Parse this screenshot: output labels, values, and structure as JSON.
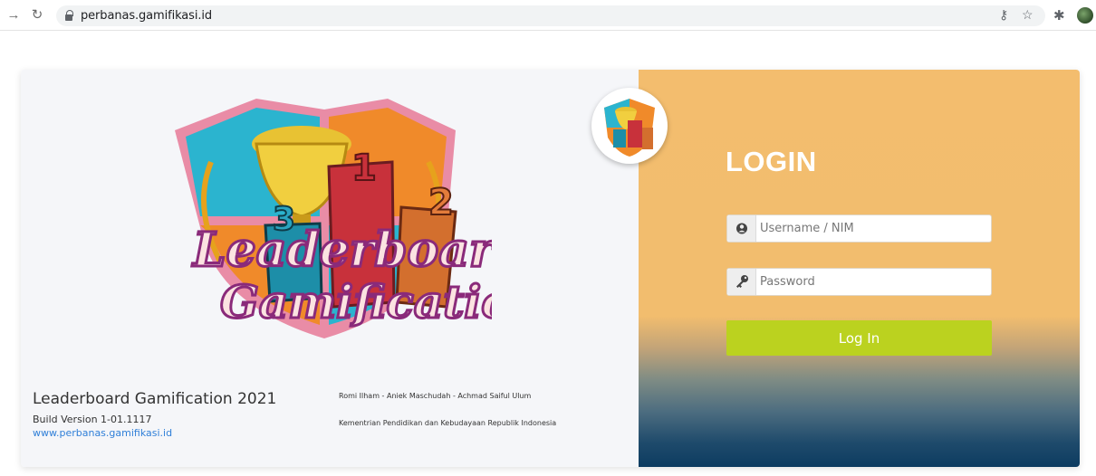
{
  "browser": {
    "url": "perbanas.gamifikasi.id",
    "back_icon": "back-arrow-icon",
    "reload_icon": "reload-icon",
    "key_icon": "key-icon",
    "star_icon": "star-icon",
    "extensions_icon": "puzzle-icon"
  },
  "branding": {
    "logo_text_line1": "Leaderboard",
    "logo_text_line2": "Gamification",
    "podium_labels": [
      "1",
      "2",
      "3"
    ],
    "app_title": "Leaderboard Gamification 2021",
    "build_version": "Build Version 1-01.1117",
    "website": "www.perbanas.gamifikasi.id",
    "authors": "Romi Ilham - Aniek Maschudah - Achmad Saiful Ulum",
    "ministry": "Kementrian Pendidikan dan Kebudayaan Republik Indonesia"
  },
  "login": {
    "title": "LOGIN",
    "username_placeholder": "Username / NIM",
    "username_value": "",
    "password_placeholder": "Password",
    "password_value": "",
    "submit_label": "Log In"
  },
  "colors": {
    "accent_button": "#bbd21f",
    "panel_top": "#f2bd6e",
    "panel_bottom": "#0d3c61",
    "link": "#2f7fd8"
  }
}
